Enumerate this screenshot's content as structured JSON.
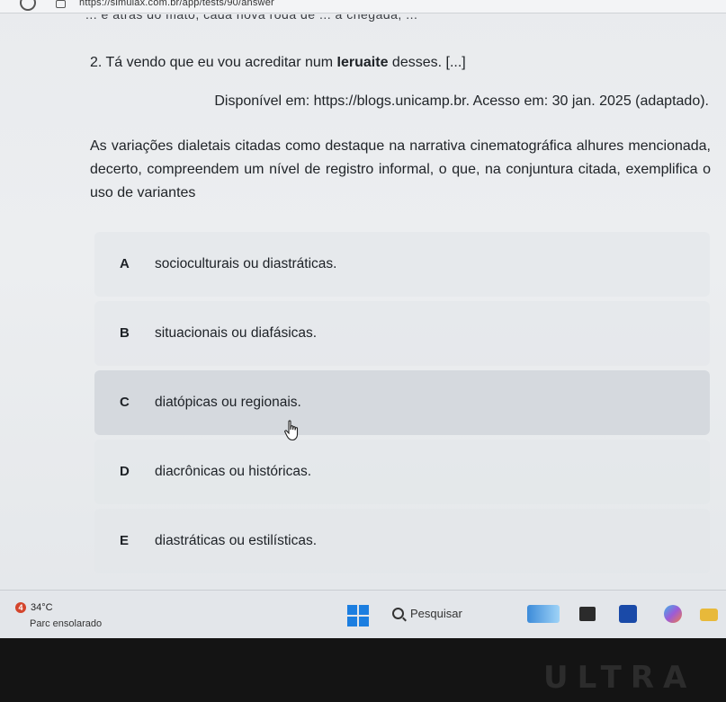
{
  "browser": {
    "url": "https://simulax.com.br/app/tests/90/answer"
  },
  "question": {
    "cut_off_line": "... é atrás do mato, cada nova roda de ... a chegada, ... ",
    "title_prefix": "2. Tá vendo que eu vou acreditar num ",
    "title_bold": "Ieruaite",
    "title_suffix": " desses. [...]",
    "source": "Disponível em: https://blogs.unicamp.br. Acesso em: 30 jan. 2025 (adaptado).",
    "stem": "As variações dialetais citadas como destaque na narrativa cinematográfica alhures mencionada, decerto, compreendem um nível de registro informal, o que, na conjuntura citada, exemplifica o uso de variantes"
  },
  "options": [
    {
      "letter": "A",
      "text": "socioculturais ou diastráticas."
    },
    {
      "letter": "B",
      "text": "situacionais ou diafásicas."
    },
    {
      "letter": "C",
      "text": "diatópicas ou regionais."
    },
    {
      "letter": "D",
      "text": "diacrônicas ou históricas."
    },
    {
      "letter": "E",
      "text": "diastráticas ou estilísticas."
    }
  ],
  "selected_option": "C",
  "taskbar": {
    "weather_badge": "4",
    "temperature": "34°C",
    "condition": "Parc ensolarado",
    "search_label": "Pesquisar"
  },
  "overlay": {
    "watermark": "ULTRA"
  },
  "colors": {
    "start": "#1c7ee0",
    "badge": "#d4452c"
  },
  "icons": [
    "reload-icon",
    "site-icon",
    "hand-cursor-icon",
    "windows-start-icon",
    "search-icon",
    "file-explorer-icon",
    "widgets-icon",
    "store-icon",
    "copilot-icon",
    "folder-icon"
  ]
}
